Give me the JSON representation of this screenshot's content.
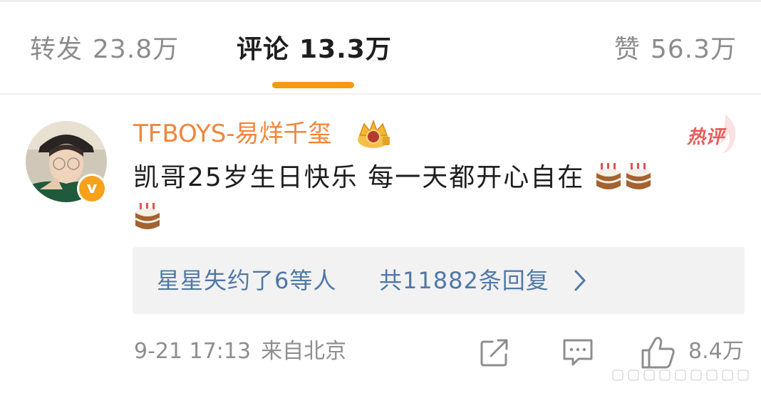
{
  "tabs": [
    {
      "label": "转发",
      "count": "23.8万",
      "active": false
    },
    {
      "label": "评论",
      "count": "13.3万",
      "active": true
    },
    {
      "label": "赞",
      "count": "56.3万",
      "active": false
    }
  ],
  "comment": {
    "username": "TFBOYS-易烊千玺",
    "hot_label": "热评",
    "text": "凯哥25岁生日快乐 每一天都开心自在",
    "emojis": [
      "cake-icon",
      "cake-icon",
      "cake-icon"
    ],
    "reply_users": "星星失约了6等人",
    "reply_count": "共11882条回复",
    "timestamp": "9-21 17:13",
    "source": "来自北京",
    "like_count": "8.4万"
  },
  "colors": {
    "accent": "#f39a15",
    "username": "#f2853a",
    "link": "#4f78a8",
    "hot": "#ea5a5a",
    "muted": "#8e8e8e"
  }
}
